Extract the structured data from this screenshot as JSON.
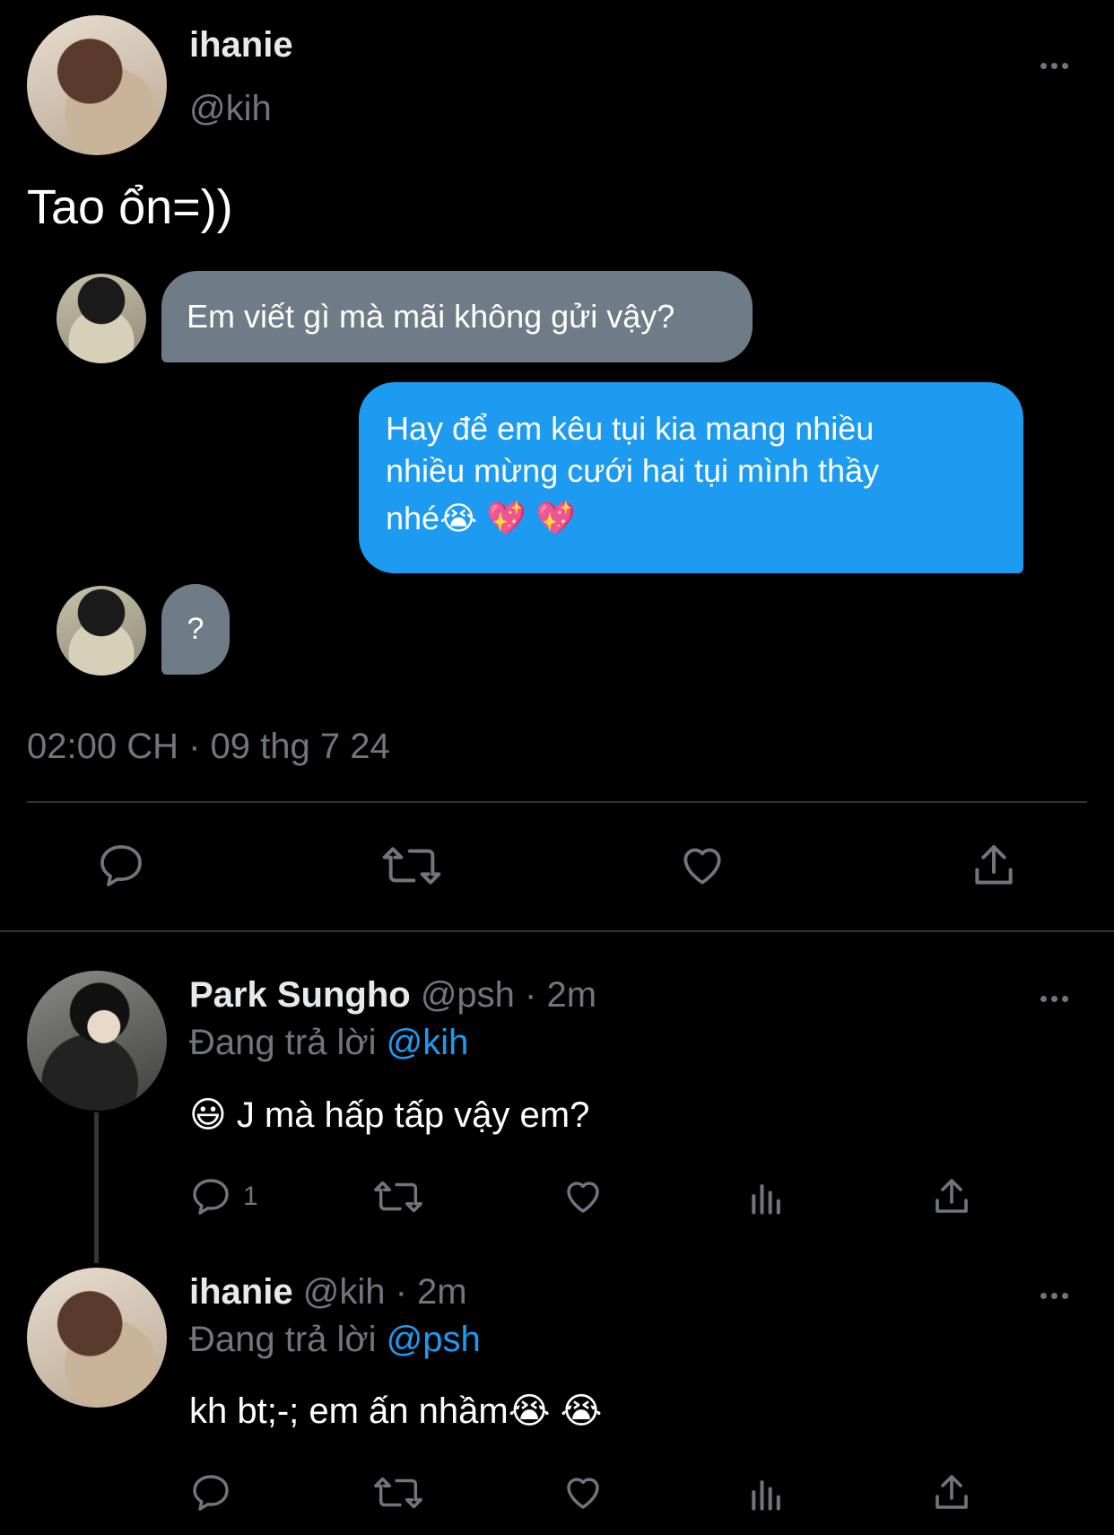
{
  "main_tweet": {
    "display_name": "ihanie",
    "handle": "@kih",
    "text": "Tao ổn=))",
    "timestamp": "02:00 CH · 09 thg 7 24",
    "messages": [
      {
        "text": "Em viết gì mà mãi không gửi vậy?",
        "from": "other"
      },
      {
        "text_line1": "Hay để em kêu tụi kia mang nhiều",
        "text_line2": "nhiều mừng cưới hai tụi mình thầy",
        "text_line3": "nhé😭 💖 💖",
        "from": "me"
      },
      {
        "text": "?",
        "from": "other"
      }
    ]
  },
  "replies": [
    {
      "display_name": "Park Sungho",
      "handle_time": "@psh · 2m",
      "replying_prefix": "Đang trả lời",
      "replying_to": "@kih",
      "text": "😃 J mà hấp tấp vậy em?",
      "reply_count": "1"
    },
    {
      "display_name": "ihanie",
      "handle_time": "@kih · 2m",
      "replying_prefix": "Đang trả lời",
      "replying_to": "@psh",
      "text": "kh bt;-; em ấn nhầm😭 😭"
    }
  ],
  "icons": {
    "reply": "speech-bubble-icon",
    "retweet": "retweet-icon",
    "like": "heart-icon",
    "views": "bar-chart-icon",
    "share": "share-icon",
    "more": "more-horizontal-icon"
  },
  "colors": {
    "accent": "#1d9bf0",
    "muted": "#71767b",
    "bubble_gray": "#6f7c88"
  }
}
